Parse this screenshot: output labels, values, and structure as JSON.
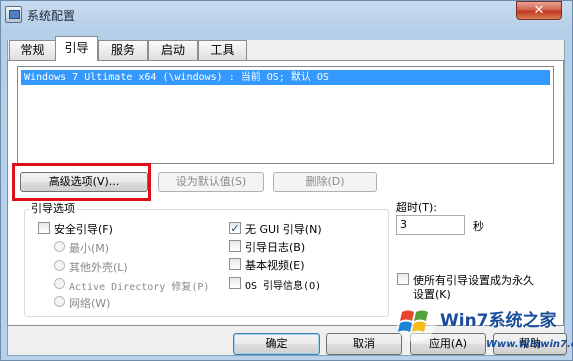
{
  "window": {
    "title": "系统配置",
    "close_glyph": "✕"
  },
  "tabs": [
    {
      "label": "常规"
    },
    {
      "label": "引导"
    },
    {
      "label": "服务"
    },
    {
      "label": "启动"
    },
    {
      "label": "工具"
    }
  ],
  "boot_entries": [
    "Windows 7 Ultimate x64 (\\windows) : 当前 OS; 默认 OS"
  ],
  "buttons": {
    "advanced": "高级选项(V)...",
    "set_default": "设为默认值(S)",
    "delete": "删除(D)"
  },
  "boot_options": {
    "title": "引导选项",
    "safe_boot": {
      "label": "安全引导(F)",
      "checked": false
    },
    "minimal": "最小(M)",
    "alternate_shell": "其他外壳(L)",
    "ad_repair": "Active Directory 修复(P)",
    "network": "网络(W)",
    "no_gui_boot": {
      "label": "无 GUI 引导(N)",
      "checked": true
    },
    "boot_log": {
      "label": "引导日志(B)",
      "checked": false
    },
    "base_video": {
      "label": "基本视频(E)",
      "checked": false
    },
    "os_boot_info": {
      "label": "OS 引导信息(O)",
      "checked": false
    }
  },
  "timeout": {
    "label": "超时(T):",
    "value": "3",
    "unit": "秒"
  },
  "make_permanent": {
    "label_line1": "使所有引导设置成为永久",
    "label_line2": "设置(K)",
    "checked": false
  },
  "footer": {
    "ok": "确定",
    "cancel": "取消",
    "apply": "应用(A)",
    "help": "帮助"
  },
  "watermark": {
    "brand": "Win7系统之家",
    "url": "Www.Winwin7.com"
  },
  "colors": {
    "selection": "#3399ff",
    "highlight_box": "#e0101a"
  }
}
